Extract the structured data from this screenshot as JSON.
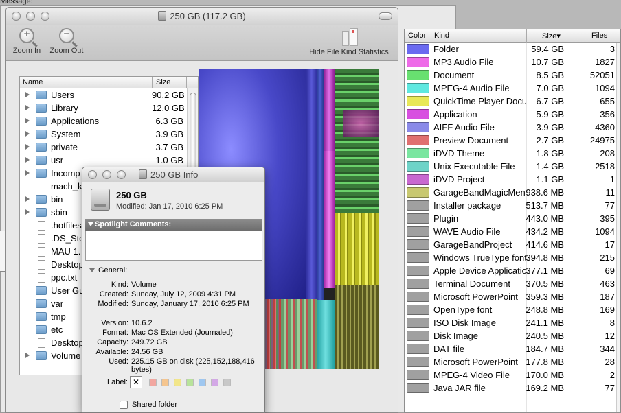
{
  "background": {
    "message_label": "Message:"
  },
  "main_window": {
    "title": "250 GB (117.2 GB)",
    "toolbar": {
      "zoom_in": "Zoom In",
      "zoom_out": "Zoom Out",
      "hide_stats": "Hide File Kind Statistics",
      "zoom_in_icon": "magnifier-plus-icon",
      "zoom_out_icon": "magnifier-minus-icon"
    },
    "file_list": {
      "headers": {
        "name": "Name",
        "size": "Size"
      },
      "rows": [
        {
          "name": "Users",
          "size": "90.2 GB",
          "type": "folder",
          "icon": "folder-icon",
          "expandable": true
        },
        {
          "name": "Library",
          "size": "12.0 GB",
          "type": "folder",
          "icon": "folder-icon",
          "expandable": true
        },
        {
          "name": "Applications",
          "size": "6.3 GB",
          "type": "folder",
          "icon": "folder-icon",
          "expandable": true
        },
        {
          "name": "System",
          "size": "3.9 GB",
          "type": "folder",
          "icon": "folder-icon",
          "expandable": true
        },
        {
          "name": "private",
          "size": "3.7 GB",
          "type": "folder",
          "icon": "folder-icon",
          "expandable": true
        },
        {
          "name": "usr",
          "size": "1.0 GB",
          "type": "folder",
          "icon": "folder-icon",
          "expandable": true
        },
        {
          "name": "Incomp",
          "size": "",
          "type": "folder",
          "icon": "folder-icon",
          "expandable": true
        },
        {
          "name": "mach_k",
          "size": "",
          "type": "doc",
          "icon": "document-icon",
          "expandable": false
        },
        {
          "name": "bin",
          "size": "",
          "type": "folder",
          "icon": "folder-icon",
          "expandable": true
        },
        {
          "name": "sbin",
          "size": "",
          "type": "folder",
          "icon": "folder-icon",
          "expandable": true
        },
        {
          "name": ".hotfiles",
          "size": "",
          "type": "doc",
          "icon": "document-icon",
          "expandable": false
        },
        {
          "name": ".DS_Sto",
          "size": "",
          "type": "doc",
          "icon": "document-icon",
          "expandable": false
        },
        {
          "name": "MAU 1.",
          "size": "",
          "type": "doc",
          "icon": "document-icon",
          "expandable": false
        },
        {
          "name": "Desktop",
          "size": "",
          "type": "doc",
          "icon": "document-icon",
          "expandable": false
        },
        {
          "name": "ppc.txt",
          "size": "",
          "type": "doc",
          "icon": "document-icon",
          "expandable": false
        },
        {
          "name": "User Gu",
          "size": "",
          "type": "folder",
          "icon": "folder-icon",
          "expandable": false
        },
        {
          "name": "var",
          "size": "",
          "type": "folder",
          "icon": "folder-icon",
          "expandable": false
        },
        {
          "name": "tmp",
          "size": "",
          "type": "folder",
          "icon": "folder-icon",
          "expandable": false
        },
        {
          "name": "etc",
          "size": "",
          "type": "folder",
          "icon": "folder-icon",
          "expandable": false
        },
        {
          "name": "Desktop",
          "size": "",
          "type": "doc",
          "icon": "document-icon",
          "expandable": false
        },
        {
          "name": "Volume",
          "size": "",
          "type": "folder",
          "icon": "folder-icon",
          "expandable": true
        }
      ]
    }
  },
  "info_panel": {
    "title": "250 GB Info",
    "name": "250 GB",
    "modified_line": "Modified: Jan 17, 2010 6:25 PM",
    "spotlight_label": "Spotlight Comments:",
    "general_label": "General:",
    "fields": [
      {
        "key": "Kind:",
        "value": "Volume"
      },
      {
        "key": "Created:",
        "value": "Sunday, July 12, 2009 4:31 PM"
      },
      {
        "key": "Modified:",
        "value": "Sunday, January 17, 2010 6:25 PM"
      },
      {
        "key": "Version:",
        "value": "10.6.2"
      },
      {
        "key": "Format:",
        "value": "Mac OS Extended (Journaled)"
      },
      {
        "key": "Capacity:",
        "value": "249.72 GB"
      },
      {
        "key": "Available:",
        "value": "24.56 GB"
      },
      {
        "key": "Used:",
        "value": "225.15 GB on disk (225,152,188,416 bytes)"
      }
    ],
    "label_key": "Label:",
    "label_none": "✕",
    "label_colors": [
      "#f2a7a0",
      "#f5c58e",
      "#f2e68a",
      "#b8e39b",
      "#9fc7f0",
      "#d3a8e6",
      "#c8c8c8"
    ],
    "shared_folder": "Shared folder"
  },
  "stats_panel": {
    "headers": {
      "color": "Color",
      "kind": "Kind",
      "size": "Size▾",
      "files": "Files"
    },
    "rows": [
      {
        "color": "#6a6af0",
        "kind": "Folder",
        "size": "59.4 GB",
        "files": "3"
      },
      {
        "color": "#ee6ae8",
        "kind": "MP3 Audio File",
        "size": "10.7 GB",
        "files": "1827"
      },
      {
        "color": "#68e070",
        "kind": "Document",
        "size": "8.5 GB",
        "files": "52051"
      },
      {
        "color": "#5ee8e0",
        "kind": "MPEG-4 Audio File",
        "size": "7.0 GB",
        "files": "1094"
      },
      {
        "color": "#e8e858",
        "kind": "QuickTime Player Document",
        "size": "6.7 GB",
        "files": "655"
      },
      {
        "color": "#d84fe0",
        "kind": "Application",
        "size": "5.9 GB",
        "files": "356"
      },
      {
        "color": "#8a8ae8",
        "kind": "AIFF Audio File",
        "size": "3.9 GB",
        "files": "4360"
      },
      {
        "color": "#e07070",
        "kind": "Preview Document",
        "size": "2.7 GB",
        "files": "24975"
      },
      {
        "color": "#7ae6a0",
        "kind": "iDVD Theme",
        "size": "1.8 GB",
        "files": "208"
      },
      {
        "color": "#6ed3c8",
        "kind": "Unix Executable File",
        "size": "1.4 GB",
        "files": "2518"
      },
      {
        "color": "#c868d0",
        "kind": "iDVD Project",
        "size": "1.1 GB",
        "files": "1"
      },
      {
        "color": "#c8c870",
        "kind": "GarageBandMagicMenu",
        "size": "938.6 MB",
        "files": "11"
      },
      {
        "color": "#a0a0a0",
        "kind": "Installer package",
        "size": "513.7 MB",
        "files": "77"
      },
      {
        "color": "#a0a0a0",
        "kind": "Plugin",
        "size": "443.0 MB",
        "files": "395"
      },
      {
        "color": "#a0a0a0",
        "kind": "WAVE Audio File",
        "size": "434.2 MB",
        "files": "1094"
      },
      {
        "color": "#a0a0a0",
        "kind": "GarageBandProject",
        "size": "414.6 MB",
        "files": "17"
      },
      {
        "color": "#a0a0a0",
        "kind": "Windows TrueType font",
        "size": "394.8 MB",
        "files": "215"
      },
      {
        "color": "#a0a0a0",
        "kind": "Apple Device Application",
        "size": "377.1 MB",
        "files": "69"
      },
      {
        "color": "#a0a0a0",
        "kind": "Terminal Document",
        "size": "370.5 MB",
        "files": "463"
      },
      {
        "color": "#a0a0a0",
        "kind": "Microsoft PowerPoint",
        "size": "359.3 MB",
        "files": "187"
      },
      {
        "color": "#a0a0a0",
        "kind": "OpenType font",
        "size": "248.8 MB",
        "files": "169"
      },
      {
        "color": "#a0a0a0",
        "kind": "ISO Disk Image",
        "size": "241.1 MB",
        "files": "8"
      },
      {
        "color": "#a0a0a0",
        "kind": "Disk Image",
        "size": "240.5 MB",
        "files": "12"
      },
      {
        "color": "#a0a0a0",
        "kind": "DAT file",
        "size": "184.7 MB",
        "files": "344"
      },
      {
        "color": "#a0a0a0",
        "kind": "Microsoft PowerPoint",
        "size": "177.8 MB",
        "files": "28"
      },
      {
        "color": "#a0a0a0",
        "kind": "MPEG-4 Video File",
        "size": "170.0 MB",
        "files": "2"
      },
      {
        "color": "#a0a0a0",
        "kind": "Java JAR file",
        "size": "169.2 MB",
        "files": "77"
      }
    ]
  }
}
